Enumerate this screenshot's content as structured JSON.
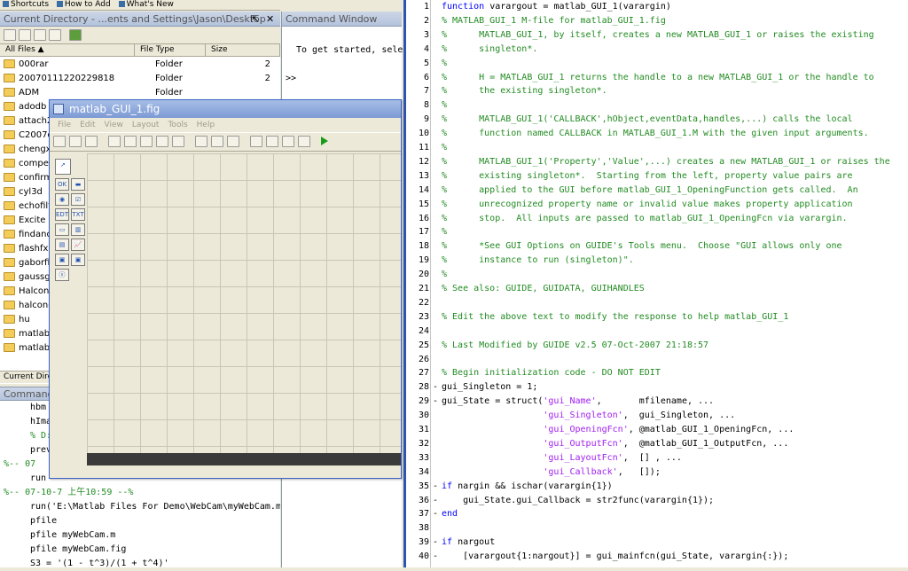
{
  "shortcuts": {
    "items": [
      "Shortcuts",
      "How to Add",
      "What's New"
    ]
  },
  "current_directory": {
    "title": "Current Directory - ...ents and Settings\\Jason\\Desktop",
    "pin": "⇱",
    "close": "✕",
    "columns": [
      "All Files ▲",
      "File Type",
      "Size"
    ],
    "files": [
      {
        "name": "000rar",
        "type": "Folder",
        "size": "2"
      },
      {
        "name": "20070111220229818",
        "type": "Folder",
        "size": "2"
      },
      {
        "name": "ADM",
        "type": "Folder",
        "size": ""
      },
      {
        "name": "adodb",
        "type": "",
        "size": ""
      },
      {
        "name": "attach2",
        "type": "",
        "size": ""
      },
      {
        "name": "C2007c",
        "type": "",
        "size": ""
      },
      {
        "name": "chengxu",
        "type": "",
        "size": ""
      },
      {
        "name": "compet",
        "type": "",
        "size": ""
      },
      {
        "name": "confirm",
        "type": "",
        "size": ""
      },
      {
        "name": "cyl3d",
        "type": "",
        "size": ""
      },
      {
        "name": "echofilt",
        "type": "",
        "size": ""
      },
      {
        "name": "Excite",
        "type": "",
        "size": ""
      },
      {
        "name": "findand",
        "type": "",
        "size": ""
      },
      {
        "name": "flashfxp",
        "type": "",
        "size": ""
      },
      {
        "name": "gaborfil",
        "type": "",
        "size": ""
      },
      {
        "name": "gaussg",
        "type": "",
        "size": ""
      },
      {
        "name": "Halcon",
        "type": "",
        "size": ""
      },
      {
        "name": "halcon-",
        "type": "",
        "size": ""
      },
      {
        "name": "hu",
        "type": "",
        "size": ""
      },
      {
        "name": "matlab",
        "type": "",
        "size": ""
      },
      {
        "name": "matlab",
        "type": "",
        "size": ""
      }
    ],
    "tab": "Current Dire"
  },
  "command_history": {
    "title": "Command",
    "lines": [
      "hbm",
      "hIma",
      "% D:",
      "prev",
      "%-- 07",
      "run",
      "%-- 07-10-7  上午10:59 --%",
      "run('E:\\Matlab Files For Demo\\WebCam\\myWebCam.m'",
      "pfile",
      "pfile myWebCam.m",
      "pfile myWebCam.fig",
      "S3 = '(1 - t^3)/(1 + t^4)'"
    ]
  },
  "command_window": {
    "title": "Command Window",
    "text": "To get started, selec",
    "prompt": ">>"
  },
  "guide": {
    "title": "matlab_GUI_1.fig",
    "menu": [
      "File",
      "Edit",
      "View",
      "Layout",
      "Tools",
      "Help"
    ],
    "palette": [
      "OK",
      "▬",
      "◉",
      "☑",
      "EDT",
      "TXT",
      "▭",
      "▥",
      "▤",
      "📈",
      "▣",
      "▣",
      "ⓧ"
    ]
  },
  "editor": {
    "lines": [
      {
        "n": "1",
        "t": "function varargout = matlab_GUI_1(varargin)",
        "c": "mix"
      },
      {
        "n": "2",
        "t": "% MATLAB_GUI_1 M-file for matlab_GUI_1.fig",
        "c": "cm"
      },
      {
        "n": "3",
        "t": "%      MATLAB_GUI_1, by itself, creates a new MATLAB_GUI_1 or raises the existing",
        "c": "cm"
      },
      {
        "n": "4",
        "t": "%      singleton*.",
        "c": "cm"
      },
      {
        "n": "5",
        "t": "%",
        "c": "cm"
      },
      {
        "n": "6",
        "t": "%      H = MATLAB_GUI_1 returns the handle to a new MATLAB_GUI_1 or the handle to",
        "c": "cm"
      },
      {
        "n": "7",
        "t": "%      the existing singleton*.",
        "c": "cm"
      },
      {
        "n": "8",
        "t": "%",
        "c": "cm"
      },
      {
        "n": "9",
        "t": "%      MATLAB_GUI_1('CALLBACK',hObject,eventData,handles,...) calls the local",
        "c": "cm"
      },
      {
        "n": "10",
        "t": "%      function named CALLBACK in MATLAB_GUI_1.M with the given input arguments.",
        "c": "cm"
      },
      {
        "n": "11",
        "t": "%",
        "c": "cm"
      },
      {
        "n": "12",
        "t": "%      MATLAB_GUI_1('Property','Value',...) creates a new MATLAB_GUI_1 or raises the",
        "c": "cm"
      },
      {
        "n": "13",
        "t": "%      existing singleton*.  Starting from the left, property value pairs are",
        "c": "cm"
      },
      {
        "n": "14",
        "t": "%      applied to the GUI before matlab_GUI_1_OpeningFunction gets called.  An",
        "c": "cm"
      },
      {
        "n": "15",
        "t": "%      unrecognized property name or invalid value makes property application",
        "c": "cm"
      },
      {
        "n": "16",
        "t": "%      stop.  All inputs are passed to matlab_GUI_1_OpeningFcn via varargin.",
        "c": "cm"
      },
      {
        "n": "17",
        "t": "%",
        "c": "cm"
      },
      {
        "n": "18",
        "t": "%      *See GUI Options on GUIDE's Tools menu.  Choose \"GUI allows only one",
        "c": "cm"
      },
      {
        "n": "19",
        "t": "%      instance to run (singleton)\".",
        "c": "cm"
      },
      {
        "n": "20",
        "t": "%",
        "c": "cm"
      },
      {
        "n": "21",
        "t": "% See also: GUIDE, GUIDATA, GUIHANDLES",
        "c": "cm"
      },
      {
        "n": "22",
        "t": "",
        "c": ""
      },
      {
        "n": "23",
        "t": "% Edit the above text to modify the response to help matlab_GUI_1",
        "c": "cm"
      },
      {
        "n": "24",
        "t": "",
        "c": ""
      },
      {
        "n": "25",
        "t": "% Last Modified by GUIDE v2.5 07-Oct-2007 21:18:57",
        "c": "cm"
      },
      {
        "n": "26",
        "t": "",
        "c": ""
      },
      {
        "n": "27",
        "t": "% Begin initialization code - DO NOT EDIT",
        "c": "cm"
      },
      {
        "n": "28",
        "t": "gui_Singleton = 1;",
        "c": ""
      },
      {
        "n": "29",
        "t": "gui_State = struct('gui_Name',       mfilename, ...",
        "c": "st29"
      },
      {
        "n": "30",
        "t": "                   'gui_Singleton',  gui_Singleton, ...",
        "c": "st"
      },
      {
        "n": "31",
        "t": "                   'gui_OpeningFcn', @matlab_GUI_1_OpeningFcn, ...",
        "c": "st"
      },
      {
        "n": "32",
        "t": "                   'gui_OutputFcn',  @matlab_GUI_1_OutputFcn, ...",
        "c": "st"
      },
      {
        "n": "33",
        "t": "                   'gui_LayoutFcn',  [] , ...",
        "c": "st"
      },
      {
        "n": "34",
        "t": "                   'gui_Callback',   []);",
        "c": "st"
      },
      {
        "n": "35",
        "t": "if nargin && ischar(varargin{1})",
        "c": "kwif"
      },
      {
        "n": "36",
        "t": "    gui_State.gui_Callback = str2func(varargin{1});",
        "c": ""
      },
      {
        "n": "37",
        "t": "end",
        "c": "kw"
      },
      {
        "n": "38",
        "t": "",
        "c": ""
      },
      {
        "n": "39",
        "t": "if nargout",
        "c": "kwif"
      },
      {
        "n": "40",
        "t": "    [varargout{1:nargout}] = gui_mainfcn(gui_State, varargin{:});",
        "c": ""
      }
    ],
    "dash_lines": [
      "28",
      "29",
      "35",
      "36",
      "37",
      "39",
      "40"
    ]
  }
}
